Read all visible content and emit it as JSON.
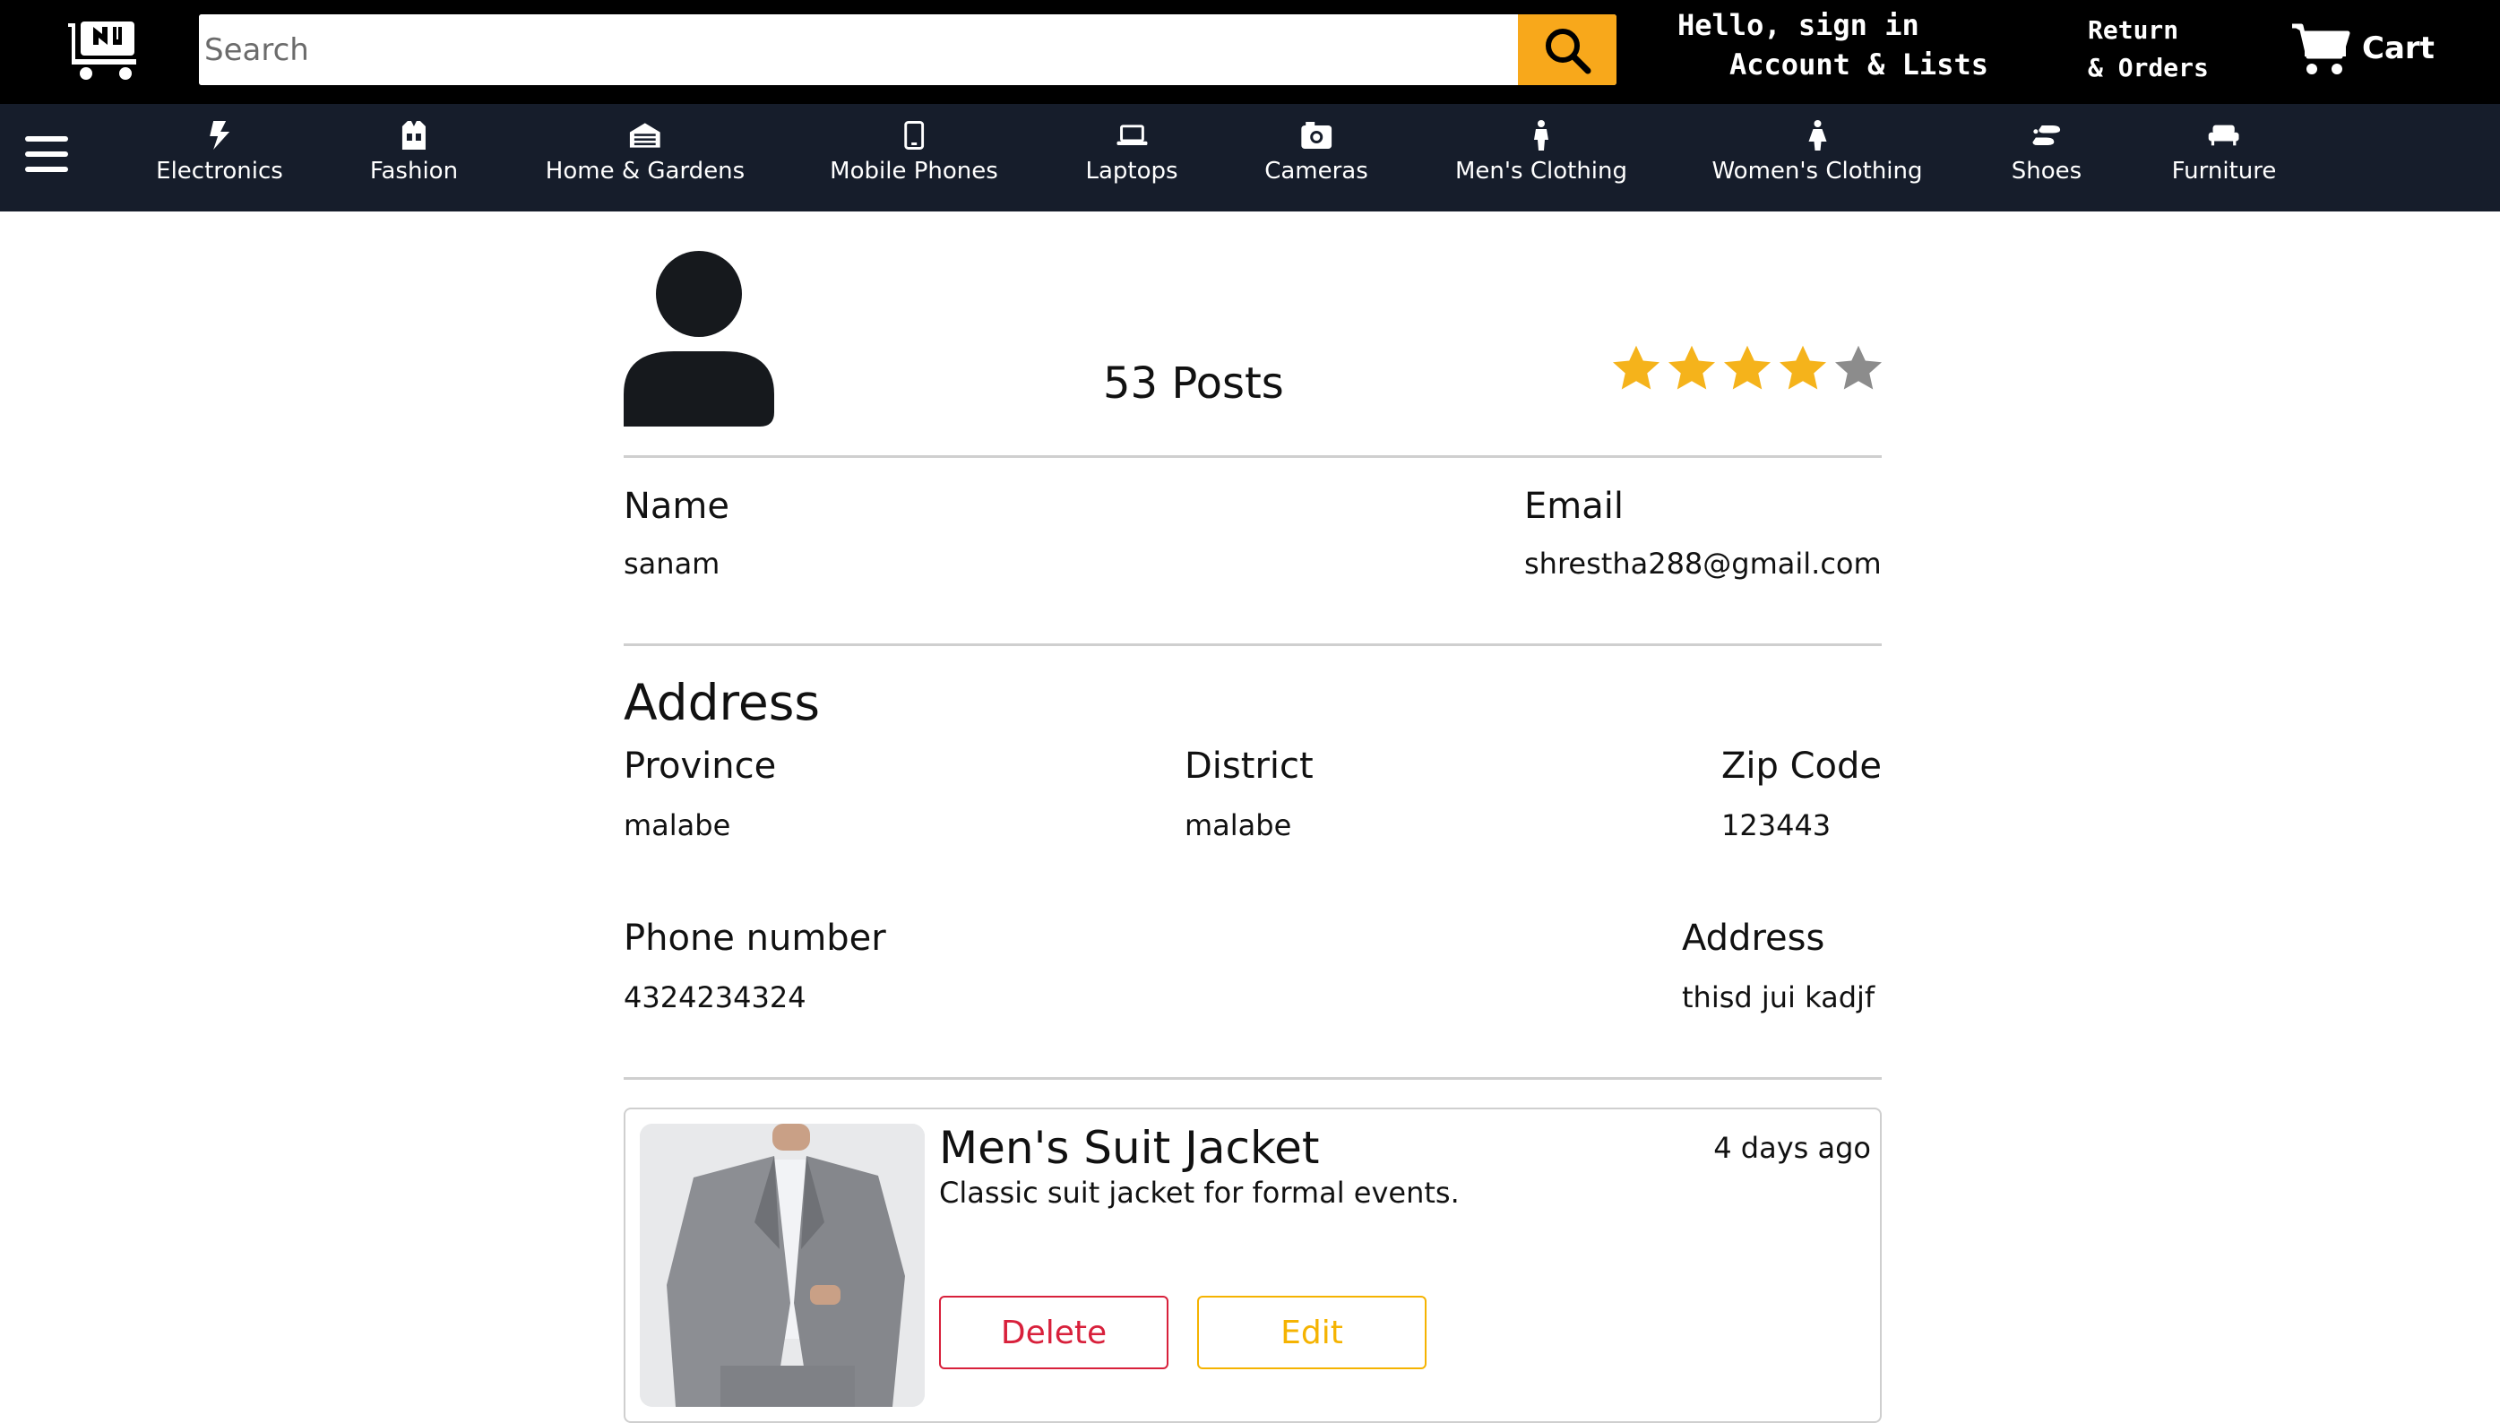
{
  "header": {
    "search_placeholder": "Search",
    "hello": "Hello, sign in",
    "account": "Account & Lists",
    "returns": "Return",
    "orders": "& Orders",
    "cart": "Cart",
    "search_button_color": "#f8a81b"
  },
  "categories": [
    {
      "label": "Electronics",
      "icon": "bolt-icon"
    },
    {
      "label": "Fashion",
      "icon": "clothing-icon"
    },
    {
      "label": "Home & Gardens",
      "icon": "house-icon"
    },
    {
      "label": "Mobile Phones",
      "icon": "mobile-icon"
    },
    {
      "label": "Laptops",
      "icon": "laptop-icon"
    },
    {
      "label": "Cameras",
      "icon": "camera-icon"
    },
    {
      "label": "Men's Clothing",
      "icon": "man-icon"
    },
    {
      "label": "Women's Clothing",
      "icon": "woman-icon"
    },
    {
      "label": "Shoes",
      "icon": "shoe-icon"
    },
    {
      "label": "Furniture",
      "icon": "couch-icon"
    }
  ],
  "profile": {
    "posts": "53 Posts",
    "rating": 4,
    "rating_max": 5,
    "name_label": "Name",
    "name_value": "sanam",
    "email_label": "Email",
    "email_value": "shrestha288@gmail.com"
  },
  "address": {
    "title": "Address",
    "province_label": "Province",
    "province_value": "malabe",
    "district_label": "District",
    "district_value": "malabe",
    "zip_label": "Zip Code",
    "zip_value": "123443",
    "phone_label": "Phone number",
    "phone_value": "4324234324",
    "address_label": "Address",
    "address_value": "thisd jui kadjf"
  },
  "post": {
    "title": "Men's Suit Jacket",
    "time": "4 days ago",
    "description": "Classic suit jacket for formal events.",
    "delete_label": "Delete",
    "edit_label": "Edit"
  },
  "colors": {
    "header_bg": "#000000",
    "nav_bg": "#161d2b",
    "star_filled": "#f5b31b",
    "star_empty": "#8c8c8c",
    "delete": "#d8203b",
    "edit": "#f5b301"
  }
}
